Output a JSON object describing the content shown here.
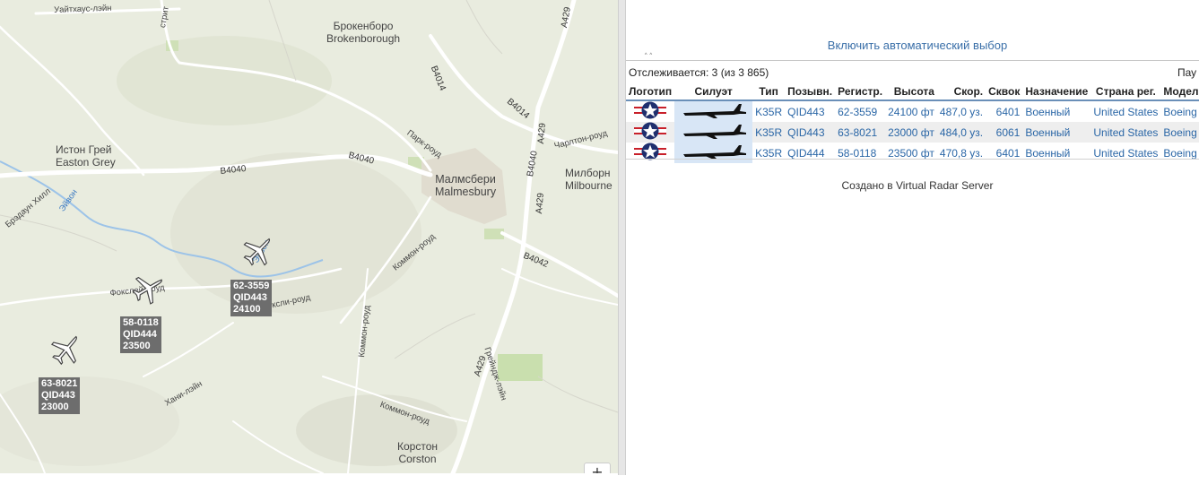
{
  "map": {
    "towns": [
      {
        "id": "brokenborough",
        "ru": "Брокенборо",
        "en": "Brokenborough"
      },
      {
        "id": "easton-grey",
        "ru": "Истон Грей",
        "en": "Easton Grey"
      },
      {
        "id": "malmesbury",
        "ru": "Малмсбери",
        "en": "Malmesbury"
      },
      {
        "id": "milbourne",
        "ru": "Милборн",
        "en": "Milbourne"
      },
      {
        "id": "corston",
        "ru": "Корстон",
        "en": "Corston"
      }
    ],
    "roads": {
      "whitehouse_lane": "Уайтхаус-лэйн",
      "street_top": "стрит",
      "b4040_a": "B4040",
      "b4040_b": "B4040",
      "b4040_c": "B4040",
      "b4014_a": "B4014",
      "b4014_b": "B4014",
      "a429_a": "A429",
      "a429_b": "A429",
      "a429_c": "A429",
      "a429_d": "A429",
      "b4042": "B4042",
      "park_road": "Парк-роуд",
      "charlton_road": "Чарлтон-роуд",
      "common_road_a": "Коммон-роуд",
      "common_road_b": "Коммон-роуд",
      "common_road_c": "Коммон-роуд",
      "foxley_road_a": "Фокслей-роуд",
      "foxley_road_b": "Фоксли-роуд",
      "bradown_hill": "Брэдаун Хилл",
      "han_lane": "Хани-лэйн",
      "grange_lane": "Грейндж-лэйн"
    },
    "water": {
      "avon_a": "Эйвон",
      "avon_b": "Эйвон"
    },
    "aircraft": [
      {
        "reg": "62-3559",
        "callsign": "QID443",
        "alt": "24100"
      },
      {
        "reg": "58-0118",
        "callsign": "QID444",
        "alt": "23500"
      },
      {
        "reg": "63-8021",
        "callsign": "QID443",
        "alt": "23000"
      }
    ],
    "zoom_in": "+"
  },
  "panel": {
    "auto_select": "Включить автоматический выбор",
    "resize_handle": "˄˄",
    "tracked": "Отслеживается: 3 (из 3 865)",
    "pause": "Пау",
    "columns": [
      "Логотип",
      "Силуэт",
      "Тип",
      "Позывн.",
      "Регистр.",
      "Высота",
      "Скор.",
      "Сквок",
      "Назначение",
      "Страна рег.",
      "Модель"
    ],
    "rows": [
      {
        "type": "K35R",
        "callsign": "QID443",
        "reg": "62-3559",
        "alt": "24100 фт",
        "speed": "487,0 уз.",
        "squawk": "6401",
        "purpose": "Военный",
        "country": "United States",
        "model": "Boeing"
      },
      {
        "type": "K35R",
        "callsign": "QID443",
        "reg": "63-8021",
        "alt": "23000 фт",
        "speed": "484,0 уз.",
        "squawk": "6061",
        "purpose": "Военный",
        "country": "United States",
        "model": "Boeing"
      },
      {
        "type": "K35R",
        "callsign": "QID444",
        "reg": "58-0118",
        "alt": "23500 фт",
        "speed": "470,8 уз.",
        "squawk": "6401",
        "purpose": "Военный",
        "country": "United States",
        "model": "Boeing"
      }
    ],
    "credit": "Создано в Virtual Radar Server"
  }
}
